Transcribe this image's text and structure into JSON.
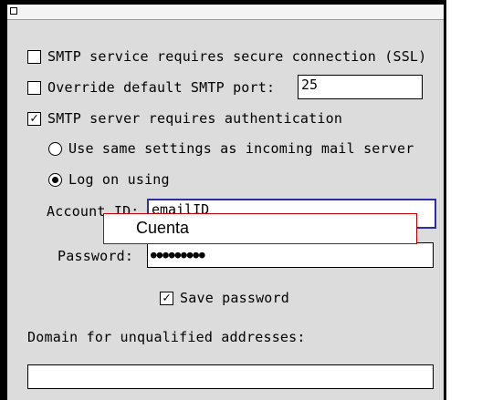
{
  "window": {
    "close_icon": "close-box-icon"
  },
  "options": {
    "ssl_label": "SMTP service requires secure connection (SSL)",
    "ssl_checked": false,
    "override_label": "Override default SMTP port:",
    "override_checked": false,
    "port_value": "25",
    "auth_label": "SMTP server requires authentication",
    "auth_checked": true,
    "auth_check_mark": "✓"
  },
  "auth": {
    "same_settings_label": "Use same settings as incoming mail server",
    "same_settings_selected": false,
    "logon_label": "Log on using",
    "logon_selected": true,
    "account_id_label": "Account ID:",
    "account_id_value": "emailID",
    "password_label": "Password:",
    "password_value": "●●●●●●●●●",
    "save_password_label": "Save password",
    "save_password_checked": true,
    "save_check_mark": "✓"
  },
  "domain": {
    "label": "Domain for unqualified addresses:",
    "value": ""
  },
  "annotation": {
    "text": "Cuenta",
    "border_color": "#c00000"
  }
}
